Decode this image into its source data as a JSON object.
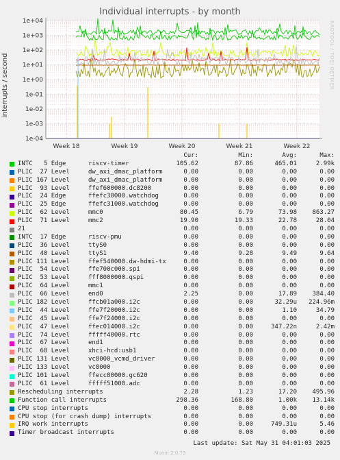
{
  "title": "Individual interrupts - by month",
  "side_text": "RRDTOOL / TOBI OETIKER",
  "footer": "Last update: Sat May 31 04:01:03 2025",
  "munin": "Munin 2.0.73",
  "legend_headers": {
    "cur": "Cur:",
    "min": "Min:",
    "avg": "Avg:",
    "max": "Max:"
  },
  "chart_data": {
    "type": "line",
    "title": "Individual interrupts - by month",
    "ylabel": "interrupts / second",
    "yscale": "log",
    "ylim": [
      0.0001,
      10000
    ],
    "yticks": [
      "1e+04",
      "1e+03",
      "1e+02",
      "1e+01",
      "1e+00",
      "1e-01",
      "1e-02",
      "1e-03",
      "1e-04"
    ],
    "xticks": [
      "Week 18",
      "Week 19",
      "Week 20",
      "Week 21",
      "Week 22"
    ],
    "grid": true,
    "series": [
      {
        "name": "INTC   5 Edge      riscv-timer",
        "color": "#00cc00",
        "cur": "105.62",
        "min": "87.86",
        "avg": "465.01",
        "max": "2.99k"
      },
      {
        "name": "PLIC  27 Level     dw_axi_dmac_platform",
        "color": "#0066b3",
        "cur": "0.00",
        "min": "0.00",
        "avg": "0.00",
        "max": "0.00"
      },
      {
        "name": "PLIC 167 Level     dw_axi_dmac_platform",
        "color": "#ff8000",
        "cur": "0.00",
        "min": "0.00",
        "avg": "0.00",
        "max": "0.00"
      },
      {
        "name": "PLIC  93 Level     ffef600000.dc8200",
        "color": "#ffcc00",
        "cur": "0.00",
        "min": "0.00",
        "avg": "0.00",
        "max": "0.00"
      },
      {
        "name": "PLIC  24 Edge      ffefc30000.watchdog",
        "color": "#330099",
        "cur": "0.00",
        "min": "0.00",
        "avg": "0.00",
        "max": "0.00"
      },
      {
        "name": "PLIC  25 Edge      ffefc31000.watchdog",
        "color": "#990099",
        "cur": "0.00",
        "min": "0.00",
        "avg": "0.00",
        "max": "0.00"
      },
      {
        "name": "PLIC  62 Level     mmc0",
        "color": "#ccff00",
        "cur": "80.45",
        "min": "6.79",
        "avg": "73.98",
        "max": "863.27"
      },
      {
        "name": "PLIC  71 Level     mmc2",
        "color": "#ff0000",
        "cur": "19.90",
        "min": "19.33",
        "avg": "22.78",
        "max": "28.04"
      },
      {
        "name": "21",
        "color": "#808080",
        "cur": "0.00",
        "min": "0.00",
        "avg": "0.00",
        "max": "0.00"
      },
      {
        "name": "INTC  17 Edge      riscv-pmu",
        "color": "#008f00",
        "cur": "0.00",
        "min": "0.00",
        "avg": "0.00",
        "max": "0.00"
      },
      {
        "name": "PLIC  36 Level     ttyS0",
        "color": "#00487d",
        "cur": "0.00",
        "min": "0.00",
        "avg": "0.00",
        "max": "0.00"
      },
      {
        "name": "PLIC  40 Level     ttyS1",
        "color": "#b35a00",
        "cur": "9.40",
        "min": "9.28",
        "avg": "9.49",
        "max": "9.64"
      },
      {
        "name": "PLIC 111 Level     ffef540000.dw-hdmi-tx",
        "color": "#b38f00",
        "cur": "0.00",
        "min": "0.00",
        "avg": "0.00",
        "max": "0.00"
      },
      {
        "name": "PLIC  54 Level     ffe700c000.spi",
        "color": "#6b006b",
        "cur": "0.00",
        "min": "0.00",
        "avg": "0.00",
        "max": "0.00"
      },
      {
        "name": "PLIC  53 Level     fff8000000.qspi",
        "color": "#8fb300",
        "cur": "0.00",
        "min": "0.00",
        "avg": "0.00",
        "max": "0.00"
      },
      {
        "name": "PLIC  64 Level     mmc1",
        "color": "#b30000",
        "cur": "0.00",
        "min": "0.00",
        "avg": "0.00",
        "max": "0.00"
      },
      {
        "name": "PLIC  66 Level     end0",
        "color": "#bebebe",
        "cur": "2.25",
        "min": "0.00",
        "avg": "17.89",
        "max": "384.40"
      },
      {
        "name": "PLIC 182 Level     ffcb01a000.i2c",
        "color": "#80ff80",
        "cur": "0.00",
        "min": "0.00",
        "avg": "32.29u",
        "max": "224.96m"
      },
      {
        "name": "PLIC  44 Level     ffe7f20000.i2c",
        "color": "#80c9ff",
        "cur": "0.00",
        "min": "0.00",
        "avg": "1.10",
        "max": "34.79"
      },
      {
        "name": "PLIC  45 Level     ffe7f24000.i2c",
        "color": "#ffc080",
        "cur": "0.00",
        "min": "0.00",
        "avg": "0.00",
        "max": "0.00"
      },
      {
        "name": "PLIC  47 Level     ffec014000.i2c",
        "color": "#ffe680",
        "cur": "0.00",
        "min": "0.00",
        "avg": "347.22n",
        "max": "2.42m"
      },
      {
        "name": "PLIC  74 Level     fffff40000.rtc",
        "color": "#aa80ff",
        "cur": "0.00",
        "min": "0.00",
        "avg": "0.00",
        "max": "0.00"
      },
      {
        "name": "PLIC  67 Level     end1",
        "color": "#ee00cc",
        "cur": "0.00",
        "min": "0.00",
        "avg": "0.00",
        "max": "0.00"
      },
      {
        "name": "PLIC  68 Level     xhci-hcd:usb1",
        "color": "#ff8080",
        "cur": "0.00",
        "min": "0.00",
        "avg": "0.00",
        "max": "0.00"
      },
      {
        "name": "PLIC 131 Level     vc8000_vcmd_driver",
        "color": "#666600",
        "cur": "0.00",
        "min": "0.00",
        "avg": "0.00",
        "max": "0.00"
      },
      {
        "name": "PLIC 133 Level     vc8000",
        "color": "#ffbfff",
        "cur": "0.00",
        "min": "0.00",
        "avg": "0.00",
        "max": "0.00"
      },
      {
        "name": "PLIC 101 Level     ffecc80000.gc620",
        "color": "#00ffcc",
        "cur": "0.00",
        "min": "0.00",
        "avg": "0.00",
        "max": "0.00"
      },
      {
        "name": "PLIC  61 Level     fffff51000.adc",
        "color": "#cc6699",
        "cur": "0.00",
        "min": "0.00",
        "avg": "0.00",
        "max": "0.00"
      },
      {
        "name": "Rescheduling interrupts",
        "color": "#999900",
        "cur": "2.28",
        "min": "1.23",
        "avg": "17.20",
        "max": "495.96"
      },
      {
        "name": "Function call interrupts",
        "color": "#00cc00",
        "cur": "298.36",
        "min": "168.80",
        "avg": "1.00k",
        "max": "13.14k"
      },
      {
        "name": "CPU stop interrupts",
        "color": "#0066b3",
        "cur": "0.00",
        "min": "0.00",
        "avg": "0.00",
        "max": "0.00"
      },
      {
        "name": "CPU stop (for crash dump) interrupts",
        "color": "#ff8000",
        "cur": "0.00",
        "min": "0.00",
        "avg": "0.00",
        "max": "0.00"
      },
      {
        "name": "IRQ work interrupts",
        "color": "#ffcc00",
        "cur": "0.00",
        "min": "0.00",
        "avg": "749.31u",
        "max": "5.46"
      },
      {
        "name": "Timer broadcast interrupts",
        "color": "#330099",
        "cur": "0.00",
        "min": "0.00",
        "avg": "0.00",
        "max": "0.00"
      }
    ]
  }
}
